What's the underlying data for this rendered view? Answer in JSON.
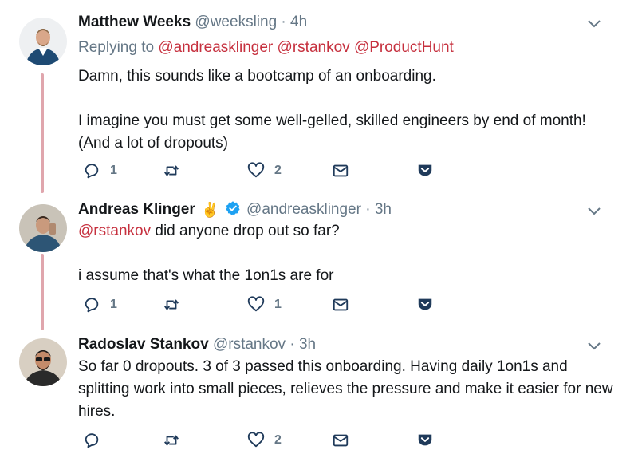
{
  "tweets": [
    {
      "name": "Matthew Weeks",
      "handle": "@weeksling",
      "dot": "·",
      "time": "4h",
      "replying_prefix": "Replying to",
      "replying_mentions": [
        "@andreasklinger",
        "@rstankov",
        "@ProductHunt"
      ],
      "paragraphs": [
        "Damn, this sounds like a bootcamp of an onboarding.",
        "I imagine you must get some well-gelled, skilled engineers by end of month! (And a lot of dropouts)"
      ],
      "reply_count": "1",
      "retweet_count": "",
      "like_count": "2"
    },
    {
      "name": "Andreas Klinger",
      "emoji": "✌️",
      "verified": true,
      "handle": "@andreasklinger",
      "dot": "·",
      "time": "3h",
      "mention": "@rstankov",
      "first_line_rest": " did anyone drop out so far?",
      "paragraphs": [
        "i assume that's what the 1on1s are for"
      ],
      "reply_count": "1",
      "retweet_count": "",
      "like_count": "1"
    },
    {
      "name": "Radoslav Stankov",
      "handle": "@rstankov",
      "dot": "·",
      "time": "3h",
      "paragraphs": [
        "So far 0 dropouts. 3 of 3 passed this onboarding. Having daily 1on1s and splitting work into small pieces, relieves the pressure and make it easier for new hires."
      ],
      "reply_count": "",
      "retweet_count": "",
      "like_count": "2"
    }
  ],
  "colors": {
    "mention": "#c6303e",
    "thread_line": "#e0a6ad",
    "icon": "#1f3a5a",
    "verified": "#1da1f2"
  }
}
